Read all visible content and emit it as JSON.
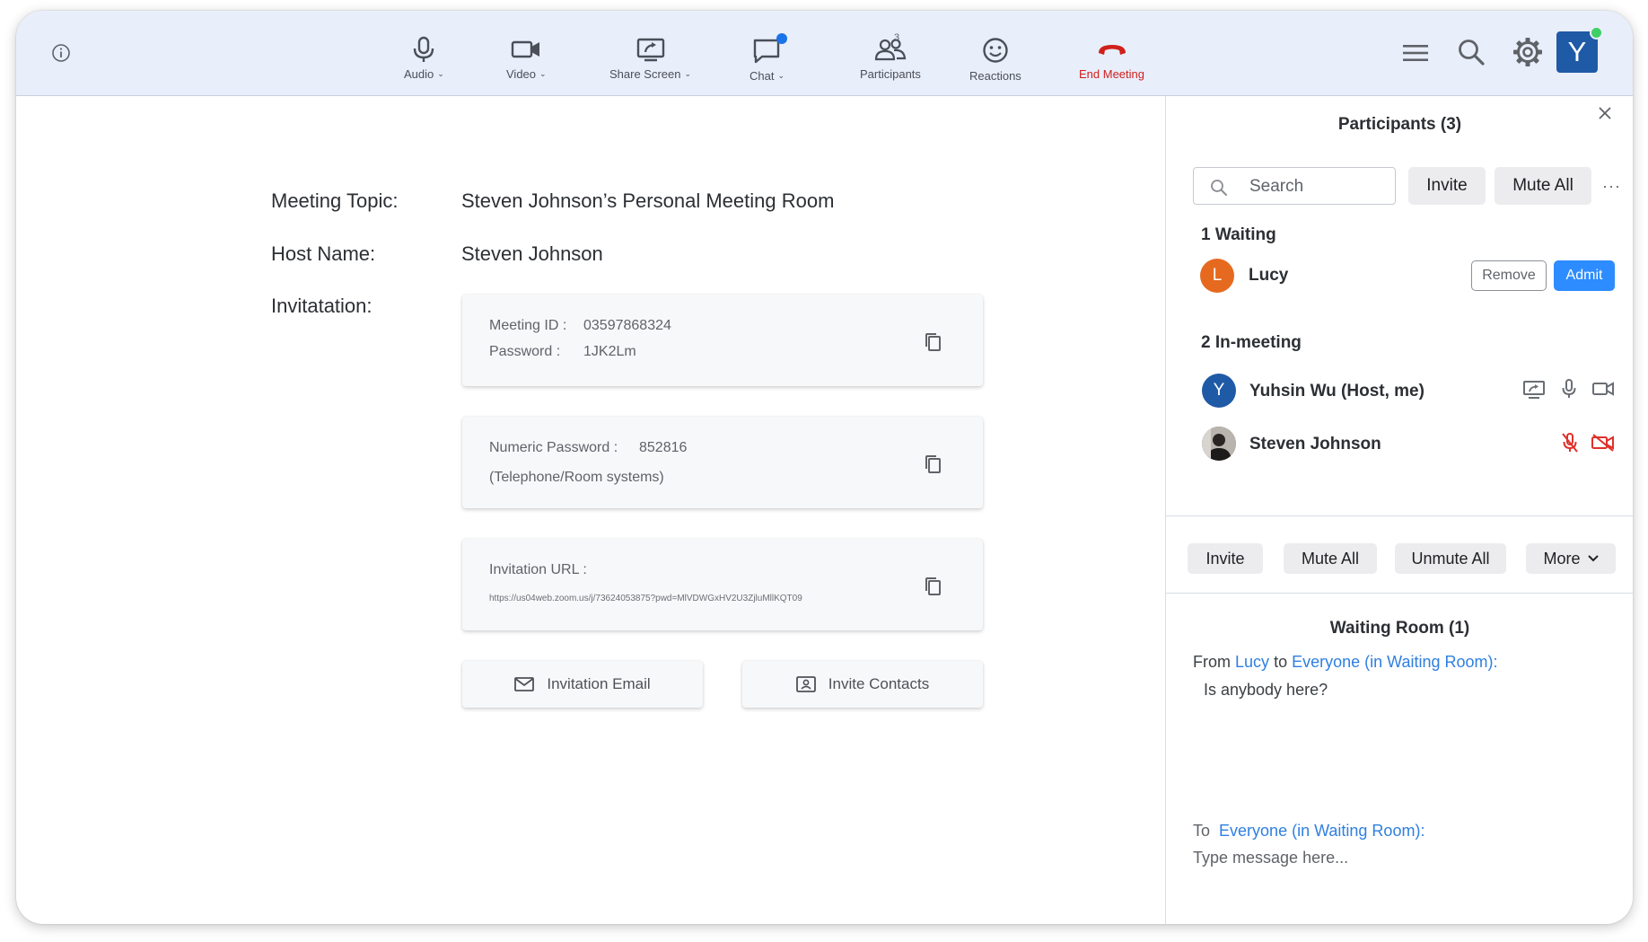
{
  "toolbar": {
    "audio_label": "Audio",
    "video_label": "Video",
    "share_label": "Share Screen",
    "chat_label": "Chat",
    "participants_label": "Participants",
    "participants_count": "3",
    "reactions_label": "Reactions",
    "end_label": "End Meeting",
    "avatar_letter": "Y",
    "icons": [
      "info-icon",
      "microphone-icon",
      "video-camera-icon",
      "share-screen-icon",
      "chat-icon",
      "participants-icon",
      "smiley-icon",
      "phone-hangup-icon",
      "hamburger-menu-icon",
      "search-icon",
      "gear-icon"
    ],
    "colors": {
      "bar_bg": "#e9eefb",
      "end_red": "#d0201b",
      "chat_dot": "#1a73e8",
      "avatar_bg": "#1f5aa6",
      "online": "#3fcf64"
    }
  },
  "meeting": {
    "topic_label": "Meeting Topic:",
    "topic_value": "Steven Johnson’s Personal Meeting Room",
    "host_label": "Host Name:",
    "host_value": "Steven Johnson",
    "invitation_label": "Invitatation:",
    "id_label": "Meeting ID :",
    "id_value": "03597868324",
    "password_label": "Password :",
    "password_value": "1JK2Lm",
    "numeric_label": "Numeric Password :",
    "numeric_value": "852816",
    "numeric_note": "(Telephone/Room systems)",
    "url_label": "Invitation URL :",
    "url_value": "https://us04web.zoom.us/j/73624053875?pwd=MlVDWGxHV2U3ZjluMllKQT09",
    "email_button": "Invitation Email",
    "contacts_button": "Invite Contacts"
  },
  "panel": {
    "title": "Participants (3)",
    "search_placeholder": "Search",
    "invite_label": "Invite",
    "mute_all_label": "Mute All",
    "more_dots": "···",
    "waiting_header": "1 Waiting",
    "waiting": [
      {
        "initial": "L",
        "name": "Lucy",
        "color": "#e56a1f"
      }
    ],
    "remove_label": "Remove",
    "admit_label": "Admit",
    "inmeeting_header": "2 In-meeting",
    "inmeeting": [
      {
        "initial": "Y",
        "name": "Yuhsin Wu (Host, me)",
        "color": "#1f5aa6",
        "status": "screen-sharing, mic on, video on"
      },
      {
        "initial": "",
        "name": "Steven Johnson",
        "color": "#7a7d82",
        "status": "mic muted, video off"
      }
    ],
    "bottom_buttons": {
      "invite": "Invite",
      "mute_all": "Mute All",
      "unmute_all": "Unmute All",
      "more": "More"
    },
    "waiting_room_title": "Waiting Room (1)",
    "chat": {
      "from_word": "From",
      "from_name": "Lucy",
      "to_word": "to",
      "to_target": "Everyone (in Waiting Room):",
      "message": "Is anybody here?",
      "compose_to_word": "To",
      "compose_target": "Everyone (in Waiting Room):",
      "compose_placeholder": "Type message here..."
    },
    "colors": {
      "admit_blue": "#2d8cff",
      "link_blue": "#2f7fe0",
      "muted_red": "#e0302a"
    }
  }
}
